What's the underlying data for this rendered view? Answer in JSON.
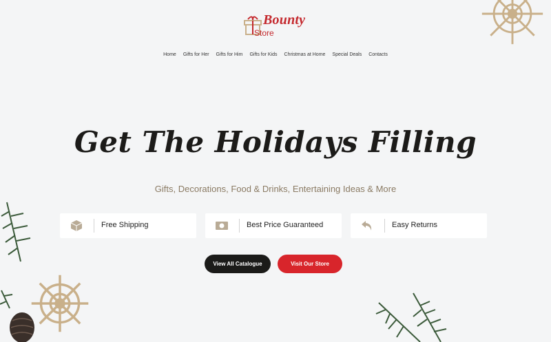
{
  "logo": {
    "line1": "Bounty",
    "line2": "Store"
  },
  "nav": [
    "Home",
    "Gifts for Her",
    "Gifts for Him",
    "Gifts for Kids",
    "Christmas at Home",
    "Special Deals",
    "Contacts"
  ],
  "hero": {
    "title": "Get The Holidays Filling",
    "subtitle": "Gifts, Decorations, Food & Drinks, Entertaining Ideas & More"
  },
  "features": [
    {
      "icon": "box-icon",
      "label": "Free Shipping"
    },
    {
      "icon": "money-icon",
      "label": "Best Price Guaranteed"
    },
    {
      "icon": "return-arrow-icon",
      "label": "Easy Returns"
    }
  ],
  "buttons": {
    "catalogue": "View All Catalogue",
    "store": "Visit Our Store"
  },
  "colors": {
    "brand_red": "#d8252b",
    "dark": "#1b1b19",
    "accent_tan": "#8a7a63",
    "background": "#f4f5f6"
  }
}
